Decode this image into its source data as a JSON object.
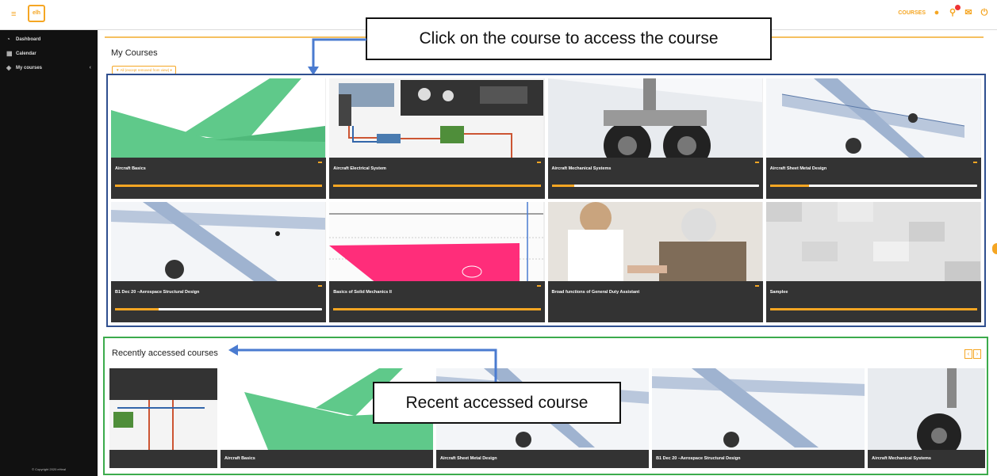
{
  "topbar": {
    "menu_icon": "hamburger-icon",
    "logo_text": "elh",
    "courses_label": "COURSES",
    "notification_badge": true
  },
  "sidebar": {
    "items": [
      {
        "label": "Dashboard",
        "icon": "dashboard-icon"
      },
      {
        "label": "Calendar",
        "icon": "calendar-icon"
      },
      {
        "label": "My courses",
        "icon": "graduation-cap-icon"
      }
    ],
    "copyright": "© Copyright 2020 eHeal"
  },
  "my_courses": {
    "title": "My Courses",
    "filter_label": "▼ All (except removed from view) ▾",
    "callout": "Click on the course to access the course",
    "courses": [
      {
        "name": "Aircraft Basics",
        "progress": 1.0,
        "image": "green-plane"
      },
      {
        "name": "Aircraft Electrical System",
        "progress": 1.0,
        "image": "cockpit-diagram"
      },
      {
        "name": "Aircraft Mechanical Systems",
        "progress": 0.11,
        "image": "landing-gear"
      },
      {
        "name": "Aircraft Sheet Metal Design",
        "progress": 0.19,
        "image": "wireframe-plane"
      },
      {
        "name": "B1 Dec 20 –Aerospace Structural Design",
        "progress": 0.21,
        "image": "wireframe-plane"
      },
      {
        "name": "Basics of Solid Mechanics II",
        "progress": 1.0,
        "image": "beam-diagram"
      },
      {
        "name": "Broad functions of General Duty Assistant",
        "progress": 0.0,
        "image": "nurse-patient"
      },
      {
        "name": "Samplee",
        "progress": 1.0,
        "image": "grey-tiles"
      }
    ]
  },
  "recent": {
    "title": "Recently accessed courses",
    "callout": "Recent accessed course",
    "prev": "‹",
    "next": "›",
    "courses": [
      {
        "name": "",
        "image": "cockpit-diagram"
      },
      {
        "name": "Aircraft Basics",
        "image": "green-plane"
      },
      {
        "name": "Aircraft Sheet Metal Design",
        "image": "wireframe-plane"
      },
      {
        "name": "B1 Dec 20 –Aerospace Structural Design",
        "image": "wireframe-plane"
      },
      {
        "name": "Aircraft Mechanical Systems",
        "image": "landing-gear"
      }
    ]
  },
  "colors": {
    "accent": "#f5a623",
    "sidebar": "#111111",
    "course_panel_border": "#2f4f8f",
    "recent_panel_border": "#3cab4c",
    "callout_arrow": "#4a7bd0"
  }
}
